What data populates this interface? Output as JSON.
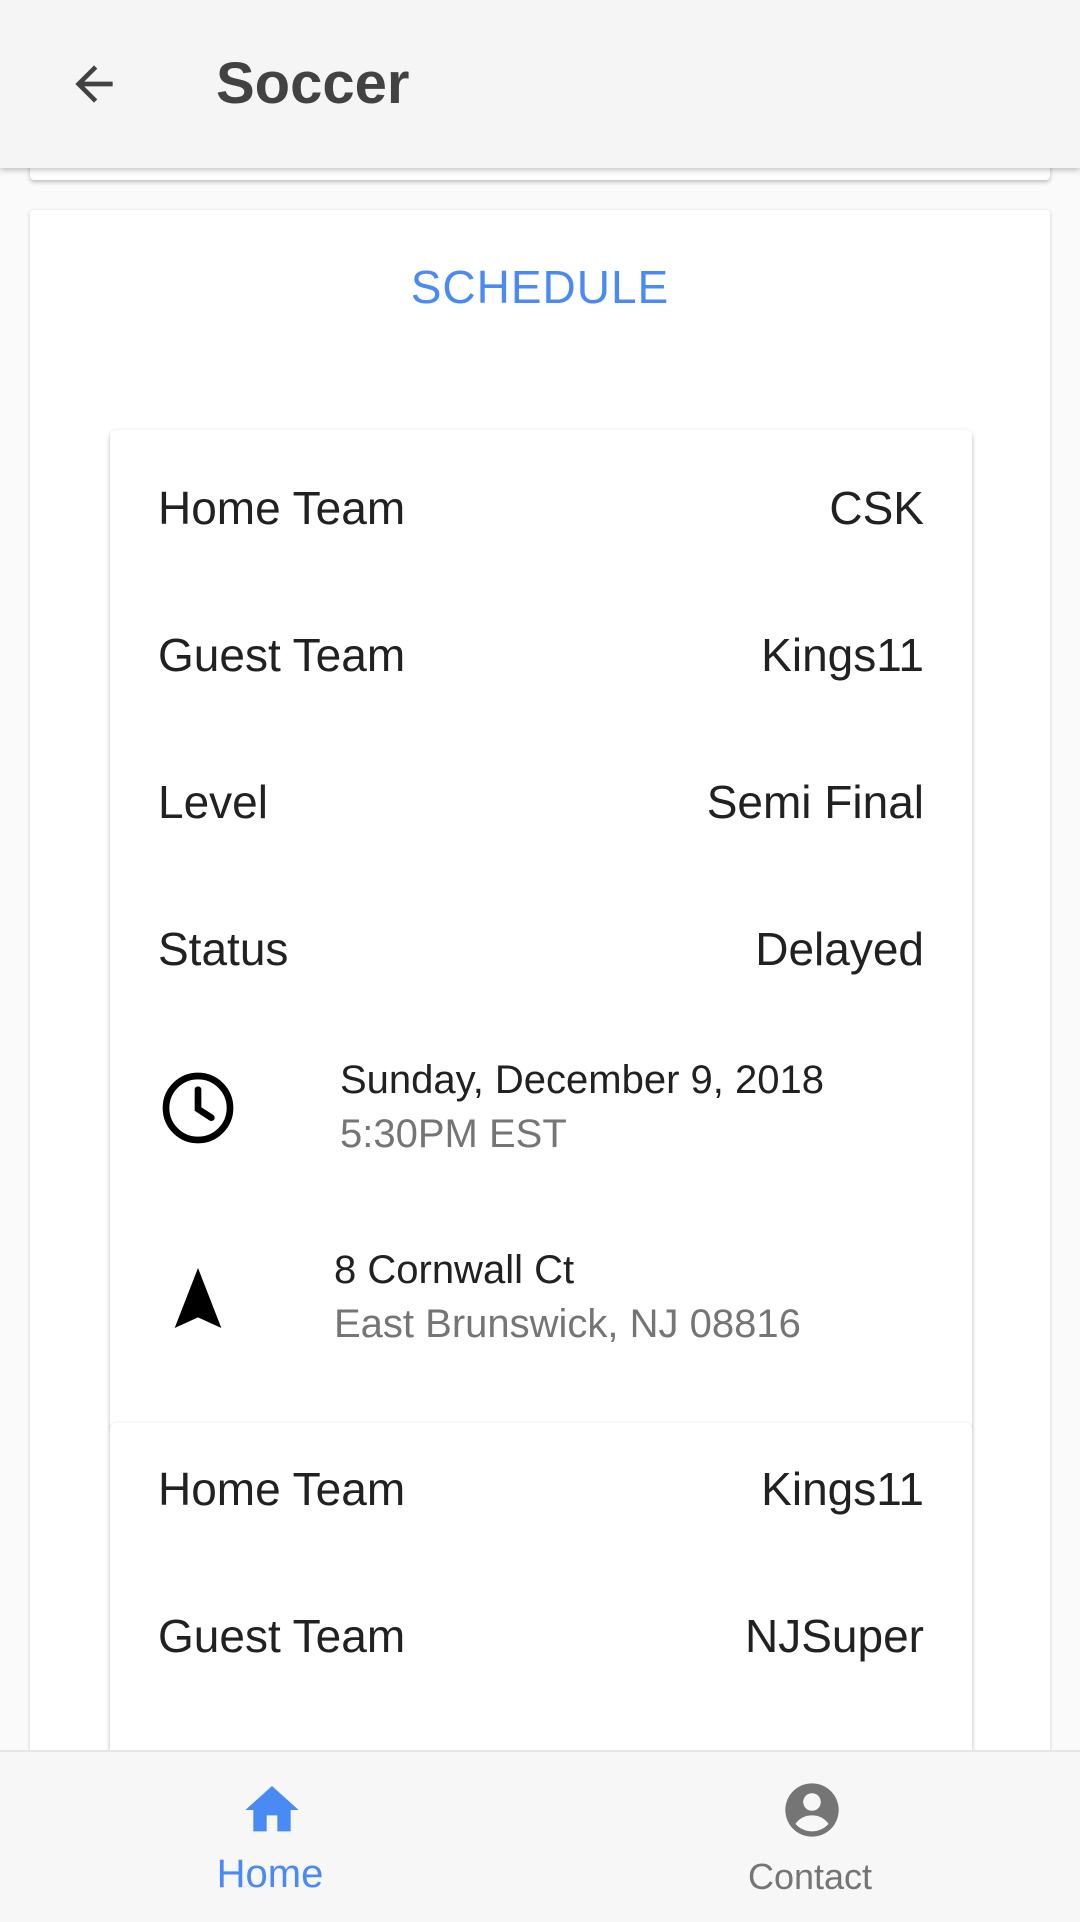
{
  "app_bar": {
    "title": "Soccer",
    "back_icon": "arrow-back-icon"
  },
  "schedule": {
    "title": "SCHEDULE",
    "games": [
      {
        "home_team_label": "Home Team",
        "home_team": "CSK",
        "guest_team_label": "Guest Team",
        "guest_team": "Kings11",
        "level_label": "Level",
        "level": "Semi Final",
        "status_label": "Status",
        "status": "Delayed",
        "date": "Sunday, December 9, 2018",
        "time": "5:30PM EST",
        "address_line1": "8 Cornwall Ct",
        "address_line2": "East Brunswick, NJ 08816"
      },
      {
        "home_team_label": "Home Team",
        "home_team": "Kings11",
        "guest_team_label": "Guest Team",
        "guest_team": "NJSuper"
      }
    ]
  },
  "bottom_nav": {
    "items": [
      {
        "label": "Home",
        "icon": "home-icon",
        "active": true
      },
      {
        "label": "Contact",
        "icon": "account-circle-icon",
        "active": false
      }
    ]
  },
  "colors": {
    "accent": "#4a8af4",
    "text_primary": "#212121",
    "text_secondary": "#757575"
  }
}
